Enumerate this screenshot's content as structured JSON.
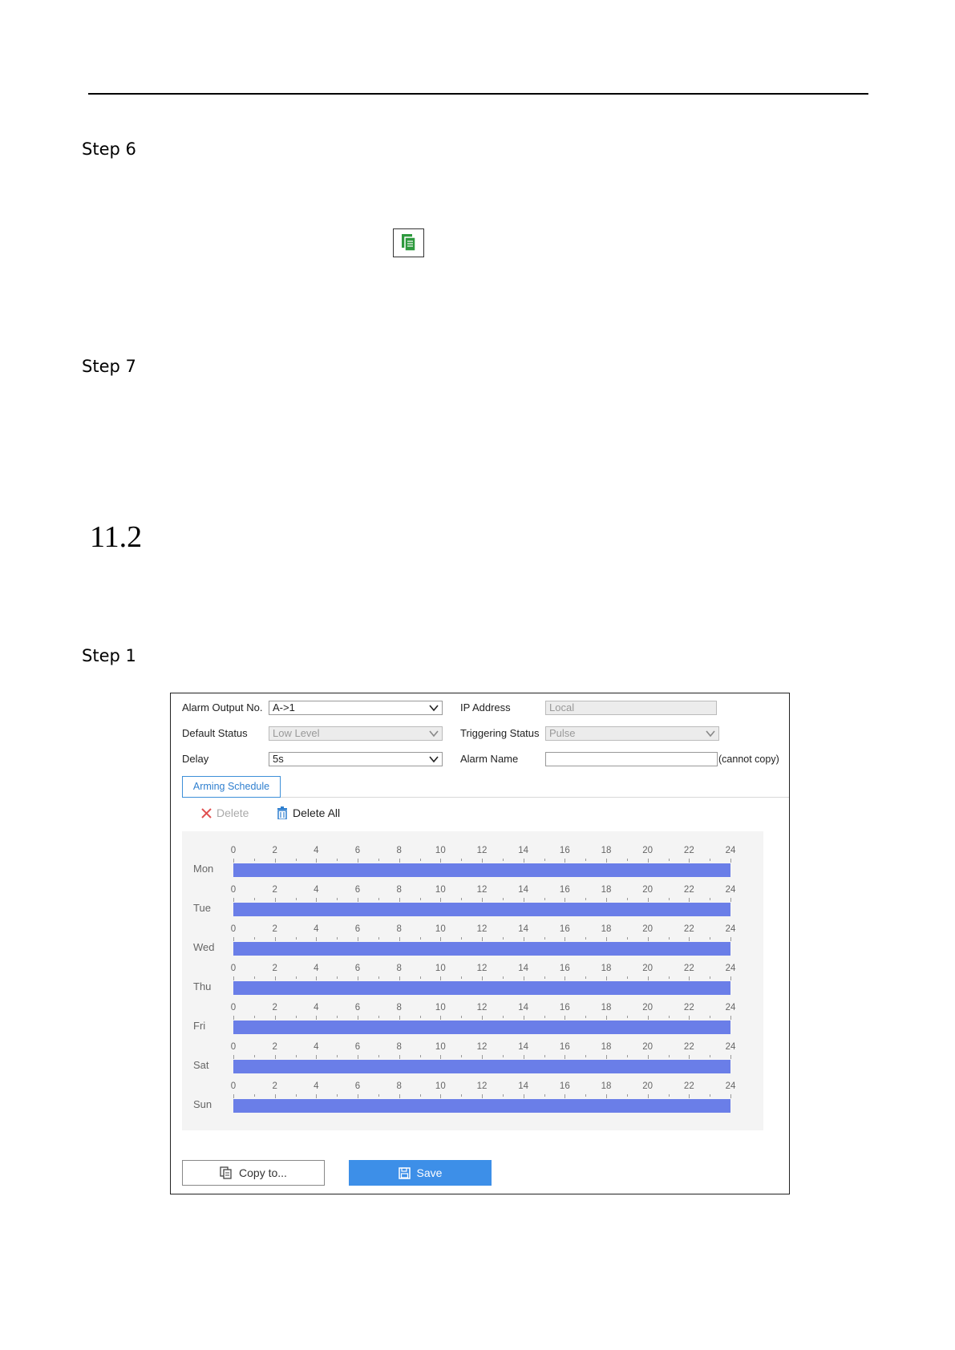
{
  "doc": {
    "step6": "Step 6",
    "step7": "Step 7",
    "section": "11.2",
    "step1": "Step 1"
  },
  "form": {
    "alarm_output_label": "Alarm Output No.",
    "alarm_output_value": "A->1",
    "ip_label": "IP Address",
    "ip_value": "Local",
    "default_status_label": "Default Status",
    "default_status_value": "Low Level",
    "triggering_label": "Triggering Status",
    "triggering_value": "Pulse",
    "delay_label": "Delay",
    "delay_value": "5s",
    "alarm_name_label": "Alarm Name",
    "alarm_name_value": "",
    "cannot_copy": "(cannot copy)"
  },
  "tabs": {
    "arming": "Arming Schedule"
  },
  "actions": {
    "delete": "Delete",
    "delete_all": "Delete All"
  },
  "schedule": {
    "days": [
      "Mon",
      "Tue",
      "Wed",
      "Thu",
      "Fri",
      "Sat",
      "Sun"
    ],
    "hours": [
      "0",
      "2",
      "4",
      "6",
      "8",
      "10",
      "12",
      "14",
      "16",
      "18",
      "20",
      "22",
      "24"
    ],
    "coverage_start_hour": 0,
    "coverage_end_hour": 24,
    "bar_color": "#6a7ee8"
  },
  "buttons": {
    "copy": "Copy to...",
    "save": "Save"
  },
  "colors": {
    "accent": "#3d8fe8",
    "copy_icon": "#2e9a3e"
  }
}
